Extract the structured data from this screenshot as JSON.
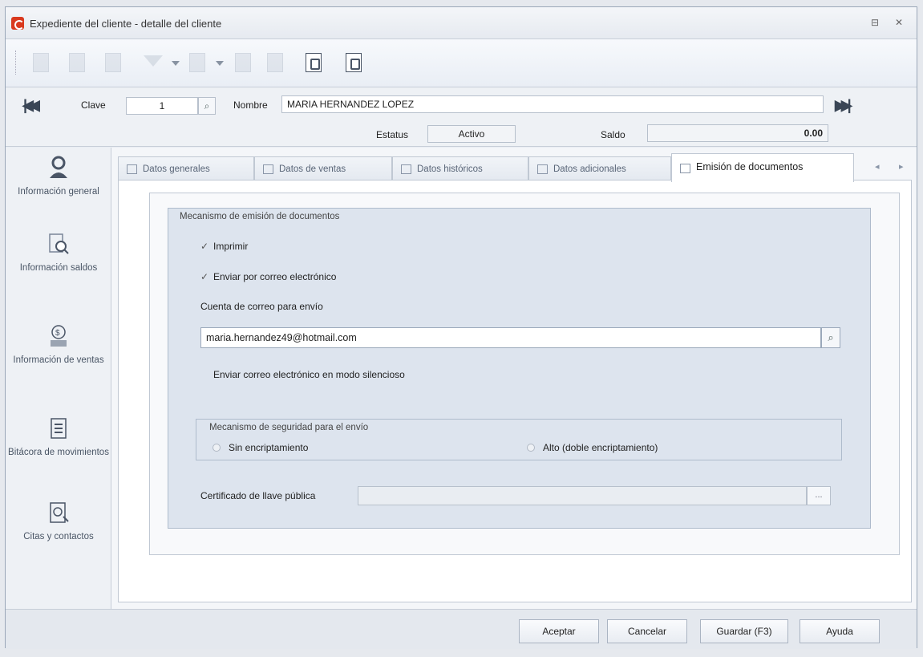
{
  "window": {
    "title": "Expediente del cliente - detalle del cliente",
    "minimize_glyph": "⊟",
    "close_glyph": "✕"
  },
  "header": {
    "clave_label": "Clave",
    "clave_value": "1",
    "nombre_label": "Nombre",
    "nombre_value": "MARIA HERNANDEZ LOPEZ",
    "estatus_label": "Estatus",
    "estatus_value": "Activo",
    "saldo_label": "Saldo",
    "saldo_value": "0.00"
  },
  "sidebar": {
    "items": [
      {
        "label": "Información general",
        "icon": "person-icon"
      },
      {
        "label": "Información saldos",
        "icon": "balance-search-icon"
      },
      {
        "label": "Información de ventas",
        "icon": "sales-money-icon"
      },
      {
        "label": "Bitácora de movimientos",
        "icon": "log-list-icon"
      },
      {
        "label": "Citas y contactos",
        "icon": "contacts-icon"
      }
    ]
  },
  "tabs": [
    {
      "label": "Datos generales",
      "icon": "home-icon"
    },
    {
      "label": "Datos de ventas",
      "icon": "sales-doc-icon"
    },
    {
      "label": "Datos históricos",
      "icon": "history-icon"
    },
    {
      "label": "Datos adicionales",
      "icon": "extra-data-icon"
    },
    {
      "label": "Emisión de documentos",
      "icon": "document-icon",
      "active": true
    }
  ],
  "emision": {
    "group_title": "Mecanismo de emisión de documentos",
    "imprimir_label": "Imprimir",
    "imprimir_checked": true,
    "correo_label": "Enviar por correo electrónico",
    "correo_checked": true,
    "cuenta_label": "Cuenta de correo para envío",
    "cuenta_value": "maria.hernandez49@hotmail.com",
    "silencioso_label": "Enviar correo electrónico en modo silencioso",
    "silencioso_checked": false,
    "seguridad_title": "Mecanismo de seguridad para el envío",
    "radio_sin": "Sin encriptamiento",
    "radio_alto": "Alto (doble encriptamiento)",
    "certificado_label": "Certificado de llave pública",
    "certificado_button": "..."
  },
  "footer": {
    "aceptar": "Aceptar",
    "cancelar": "Cancelar",
    "guardar": "Guardar (F3)",
    "ayuda": "Ayuda"
  }
}
